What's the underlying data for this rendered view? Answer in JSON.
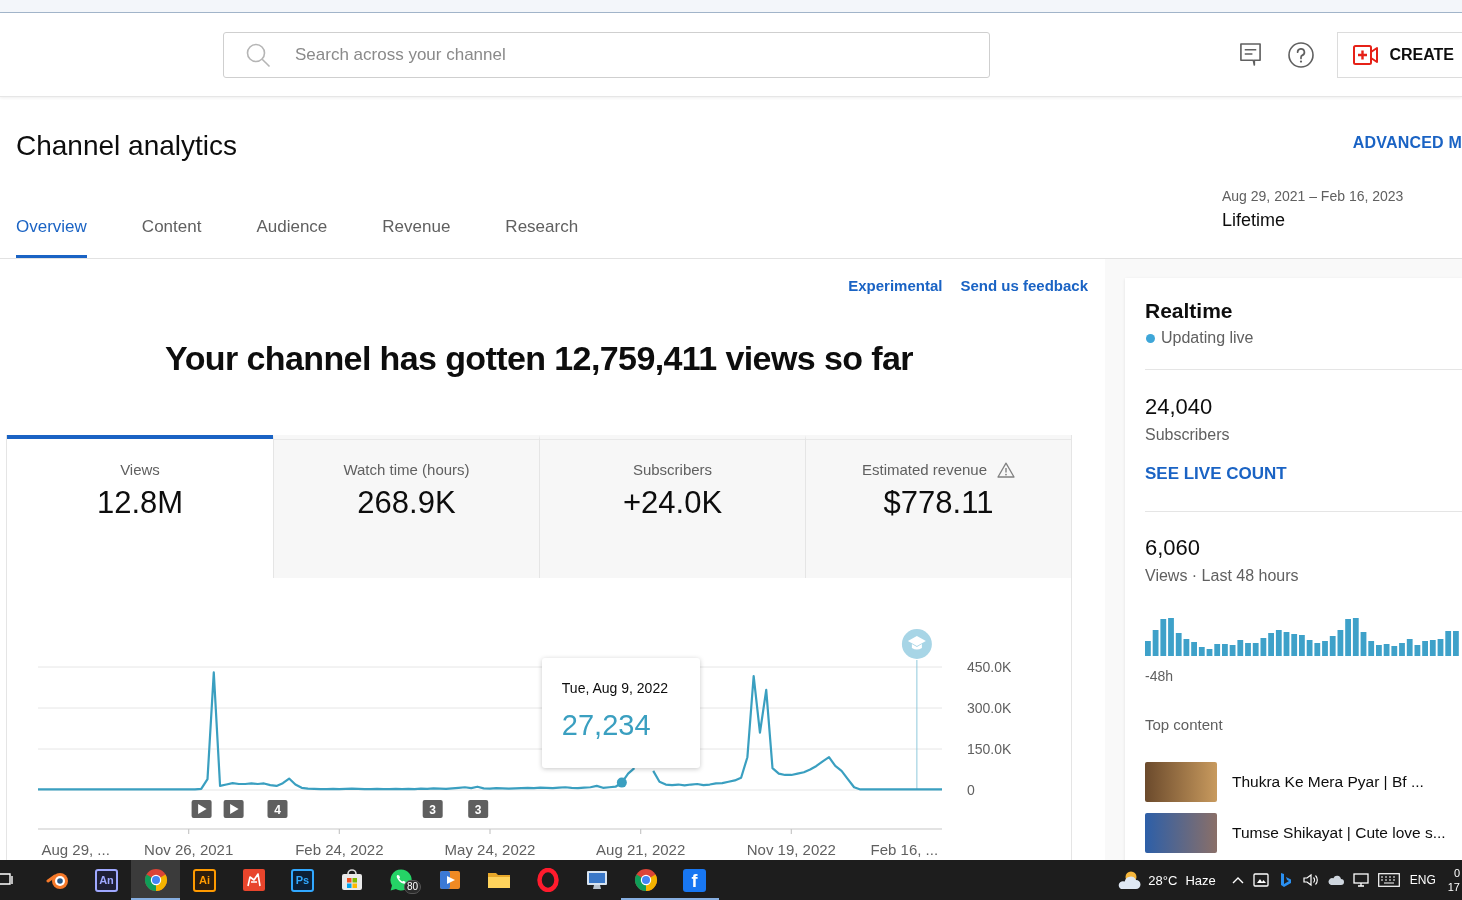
{
  "top_bar": {
    "search": {
      "placeholder": "Search across your channel"
    },
    "create_button": {
      "label": "CREATE"
    }
  },
  "header": {
    "title": "Channel analytics",
    "advanced_link": "ADVANCED M",
    "date_range": "Aug 29, 2021 – Feb 16, 2023",
    "period": "Lifetime"
  },
  "tabs": [
    {
      "label": "Overview",
      "selected": true
    },
    {
      "label": "Content",
      "selected": false
    },
    {
      "label": "Audience",
      "selected": false
    },
    {
      "label": "Revenue",
      "selected": false
    },
    {
      "label": "Research",
      "selected": false
    }
  ],
  "overview": {
    "links": [
      "Experimental",
      "Send us feedback"
    ],
    "headline": "Your channel has gotten 12,759,411 views so far",
    "metrics": [
      {
        "label": "Views",
        "value": "12.8M",
        "selected": true,
        "warning": false
      },
      {
        "label": "Watch time (hours)",
        "value": "268.9K",
        "selected": false,
        "warning": false
      },
      {
        "label": "Subscribers",
        "value": "+24.0K",
        "selected": false,
        "warning": false
      },
      {
        "label": "Estimated revenue",
        "value": "$778.11",
        "selected": false,
        "warning": true
      }
    ],
    "chart": {
      "chart_data": {
        "type": "line",
        "categories": [
          null,
          null,
          null,
          null,
          null,
          null,
          "Aug 29, ...",
          null,
          null,
          null,
          null,
          null,
          null,
          null,
          null,
          null,
          null,
          null,
          null,
          null,
          null,
          null,
          null,
          null,
          "Nov 26, 2021",
          null,
          null,
          null,
          null,
          null,
          null,
          null,
          null,
          null,
          null,
          null,
          null,
          null,
          null,
          null,
          null,
          null,
          null,
          null,
          null,
          null,
          null,
          null,
          "Feb 24, 2022",
          null,
          null,
          null,
          null,
          null,
          null,
          null,
          null,
          null,
          null,
          null,
          null,
          null,
          null,
          null,
          null,
          null,
          null,
          null,
          null,
          null,
          null,
          null,
          "May 24, 2022",
          null,
          null,
          null,
          null,
          null,
          null,
          null,
          null,
          null,
          null,
          null,
          null,
          null,
          null,
          null,
          null,
          null,
          null,
          null,
          null,
          null,
          null,
          null,
          "Aug 21, 2022",
          null,
          null,
          null,
          null,
          null,
          null,
          null,
          null,
          null,
          null,
          null,
          null,
          null,
          null,
          null,
          null,
          null,
          null,
          null,
          null,
          null,
          null,
          null,
          "Nov 19, 2022",
          null,
          null,
          null,
          null,
          null,
          null,
          null,
          null,
          null,
          null,
          null,
          null,
          null,
          null,
          null,
          null,
          null,
          "Feb 16, ...",
          null,
          null,
          null,
          null,
          null,
          null
        ],
        "series": [
          {
            "color": "#3a9fc0",
            "values": [
              2000,
              2000,
              2000,
              2000,
              2000,
              2000,
              2000,
              2000,
              2000,
              2000,
              2000,
              2000,
              2000,
              2000,
              2000,
              2000,
              2000,
              2000,
              2000,
              2000,
              2000,
              2000,
              2000,
              2000,
              2000,
              2000,
              4000,
              40000,
              430000,
              15000,
              20000,
              25000,
              22000,
              22000,
              24000,
              22000,
              24000,
              18000,
              15000,
              25000,
              42000,
              20000,
              8000,
              5000,
              4000,
              3000,
              3000,
              4000,
              3000,
              4000,
              5000,
              4000,
              3000,
              3000,
              4000,
              3000,
              3000,
              4000,
              3000,
              4000,
              3000,
              5000,
              4000,
              6000,
              5000,
              4000,
              6000,
              8000,
              10000,
              7000,
              12000,
              6000,
              5000,
              7000,
              6000,
              5000,
              6000,
              7000,
              8000,
              7000,
              9000,
              8000,
              7000,
              9000,
              10000,
              8000,
              7000,
              9000,
              10000,
              15000,
              8000,
              10000,
              12000,
              27000,
              60000,
              80000,
              null,
              null,
              70000,
              30000,
              20000,
              18000,
              20000,
              17000,
              20000,
              22000,
              18000,
              20000,
              24000,
              25000,
              30000,
              35000,
              45000,
              120000,
              417000,
              210000,
              366000,
              80000,
              60000,
              55000,
              55000,
              60000,
              65000,
              75000,
              88000,
              105000,
              120000,
              88000,
              70000,
              40000,
              10000,
              2000,
              2000,
              2000,
              2000,
              2000,
              2000,
              2000,
              2000,
              2000,
              2000,
              2000,
              2000,
              2000,
              2000
            ]
          }
        ],
        "ylim": [
          0,
          450000
        ],
        "yticks": [
          {
            "value": 0,
            "label": "0"
          },
          {
            "value": 150000,
            "label": "150.0K"
          },
          {
            "value": 300000,
            "label": "300.0K"
          },
          {
            "value": 450000,
            "label": "450.0K"
          }
        ]
      },
      "tooltip": {
        "date": "Tue, Aug 9, 2022",
        "value": "27,234"
      },
      "markers": [
        {
          "kind": "play"
        },
        {
          "kind": "play"
        },
        {
          "kind": "count",
          "label": "4"
        },
        {
          "kind": "count",
          "label": "3"
        },
        {
          "kind": "count",
          "label": "3"
        }
      ]
    }
  },
  "realtime": {
    "title": "Realtime",
    "status": "Updating live",
    "subscribers": {
      "value": "24,040",
      "label": "Subscribers",
      "link": "SEE LIVE COUNT"
    },
    "views": {
      "value": "6,060",
      "label": "Views · Last 48 hours",
      "axis_label": "-48h"
    },
    "top_content": {
      "heading": "Top content",
      "items": [
        {
          "title": "Thukra Ke Mera Pyar | Bf ..."
        },
        {
          "title": "Tumse Shikayat | Cute love s..."
        }
      ]
    }
  },
  "taskbar": {
    "apps": [
      {
        "kind": "ring",
        "selected": false,
        "running": false
      },
      {
        "kind": "letter",
        "label": "An",
        "color": "#9fa8ff",
        "selected": false,
        "running": false
      },
      {
        "kind": "browser",
        "selected": true,
        "running": true
      },
      {
        "kind": "letter",
        "label": "Ai",
        "color": "#ff9a00",
        "selected": false,
        "running": false
      },
      {
        "kind": "paint",
        "selected": false,
        "running": false
      },
      {
        "kind": "letter",
        "label": "Ps",
        "color": "#31a8ff",
        "selected": false,
        "running": false
      },
      {
        "kind": "store",
        "selected": false,
        "running": false
      },
      {
        "kind": "chat",
        "badge": "80",
        "selected": false,
        "running": false
      },
      {
        "kind": "player",
        "selected": false,
        "running": false
      },
      {
        "kind": "folder",
        "selected": false,
        "running": false
      },
      {
        "kind": "hoop",
        "selected": false,
        "running": false
      },
      {
        "kind": "monitor",
        "selected": false,
        "running": false
      },
      {
        "kind": "browser",
        "selected": false,
        "running": true
      },
      {
        "kind": "square",
        "label": "f",
        "color": "#1877f2",
        "selected": false,
        "running": true
      }
    ],
    "weather": {
      "temperature": "28°C",
      "condition": "Haze"
    },
    "language": "ENG",
    "clock": [
      "0",
      "17"
    ]
  }
}
